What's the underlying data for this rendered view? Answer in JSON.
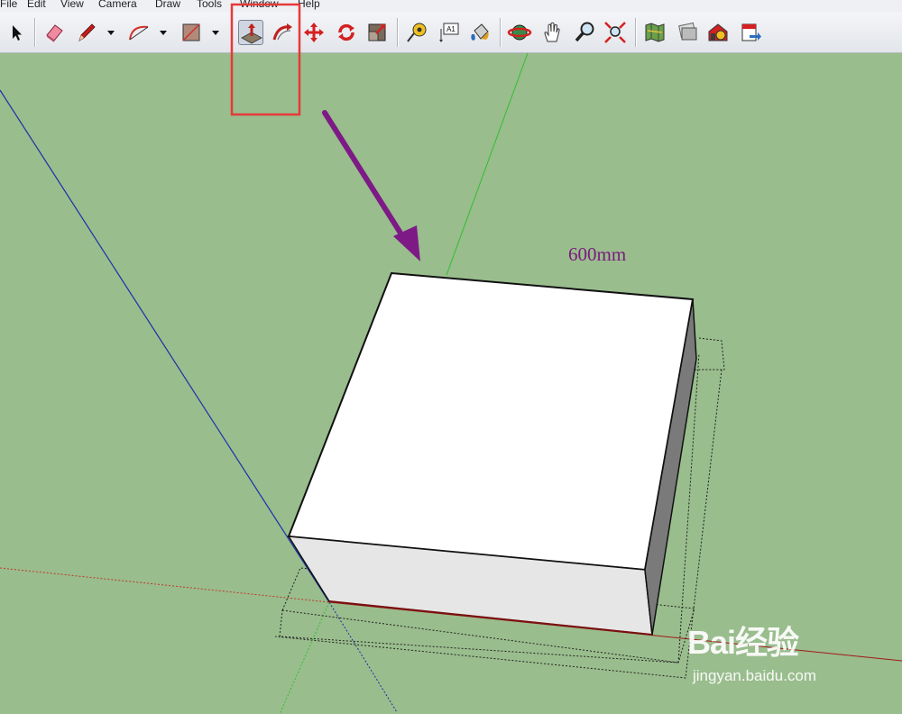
{
  "menu": [
    "File",
    "Edit",
    "View",
    "Camera",
    "Draw",
    "Tools",
    "Window",
    "Help"
  ],
  "toolbar": {
    "tools": [
      {
        "name": "select-tool",
        "icon": "arrow-cursor-icon"
      },
      {
        "name": "eraser-tool",
        "icon": "eraser-icon"
      },
      {
        "name": "pencil-tool",
        "icon": "pencil-icon"
      },
      {
        "name": "arc-tool",
        "icon": "arc-icon"
      },
      {
        "name": "rectangle-tool",
        "icon": "rectangle-icon"
      },
      {
        "name": "push-pull-tool",
        "icon": "push-pull-icon",
        "active": true
      },
      {
        "name": "follow-me-tool",
        "icon": "follow-me-icon"
      },
      {
        "name": "move-tool",
        "icon": "move-icon"
      },
      {
        "name": "rotate-tool",
        "icon": "rotate-icon"
      },
      {
        "name": "scale-tool",
        "icon": "scale-icon"
      },
      {
        "name": "tape-measure-tool",
        "icon": "tape-measure-icon"
      },
      {
        "name": "text-tool",
        "icon": "text-label-icon",
        "text": "A1"
      },
      {
        "name": "paint-bucket-tool",
        "icon": "paint-bucket-icon"
      },
      {
        "name": "orbit-tool",
        "icon": "orbit-icon"
      },
      {
        "name": "pan-tool",
        "icon": "hand-icon"
      },
      {
        "name": "zoom-tool",
        "icon": "magnifier-icon"
      },
      {
        "name": "zoom-extents-tool",
        "icon": "zoom-extents-icon"
      },
      {
        "name": "components-tool",
        "icon": "map-icon"
      },
      {
        "name": "photo-textures-tool",
        "icon": "photo-icon"
      },
      {
        "name": "warehouse-tool",
        "icon": "warehouse-icon"
      },
      {
        "name": "share-model-tool",
        "icon": "share-icon"
      }
    ]
  },
  "viewport": {
    "dimension_label": "600mm",
    "colors": {
      "background": "#99bd8d",
      "highlight_box": "#e53a3a",
      "arrow": "#7d1a86",
      "axis_blue": "#1c2fa8",
      "axis_green": "#2fbf2f",
      "axis_red": "#c0392b"
    }
  },
  "watermark": {
    "brand": "Bai经验",
    "url": "jingyan.baidu.com"
  }
}
